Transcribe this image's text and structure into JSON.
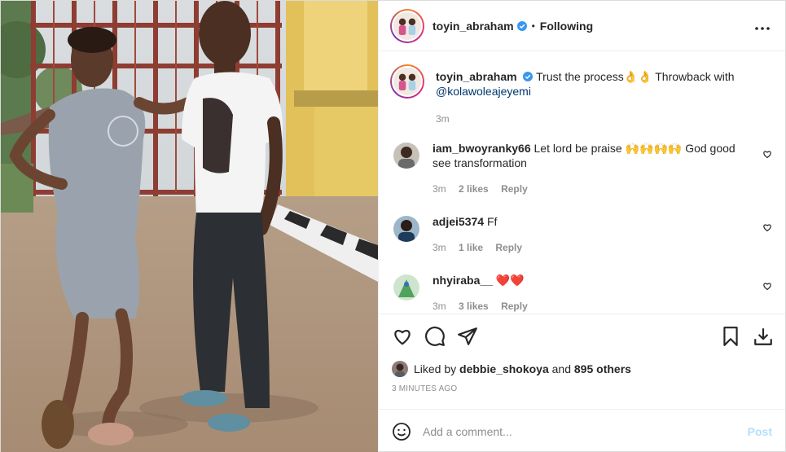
{
  "header": {
    "username": "toyin_abraham",
    "separator": "•",
    "follow_state": "Following",
    "more_label": "•••"
  },
  "caption": {
    "username": "toyin_abraham",
    "text": "Trust the process👌👌 Throwback with",
    "mention": "@kolawoleajeyemi",
    "time": "3m"
  },
  "comments": [
    {
      "username": "iam_bwoyranky66",
      "text": "Let lord be praise 🙌🙌🙌🙌 God good see transformation",
      "time": "3m",
      "likes": "2 likes",
      "reply": "Reply"
    },
    {
      "username": "adjei5374",
      "text": "Ff",
      "time": "3m",
      "likes": "1 like",
      "reply": "Reply"
    },
    {
      "username": "nhyiraba__",
      "text": "❤️❤️",
      "time": "3m",
      "likes": "3 likes",
      "reply": "Reply"
    }
  ],
  "likes": {
    "prefix": "Liked by",
    "user": "debbie_shokoya",
    "and": "and",
    "others": "895 others"
  },
  "timestamp": "3 MINUTES AGO",
  "add_comment": {
    "placeholder": "Add a comment...",
    "post_label": "Post"
  },
  "colors": {
    "link": "#00376b",
    "muted": "#8e8e8e",
    "post_disabled": "#b2dffc",
    "verified": "#3897f0"
  },
  "icons": [
    "heart-icon",
    "comment-icon",
    "share-icon",
    "bookmark-icon",
    "download-icon",
    "emoji-icon",
    "verified-badge-icon",
    "more-options-icon"
  ]
}
